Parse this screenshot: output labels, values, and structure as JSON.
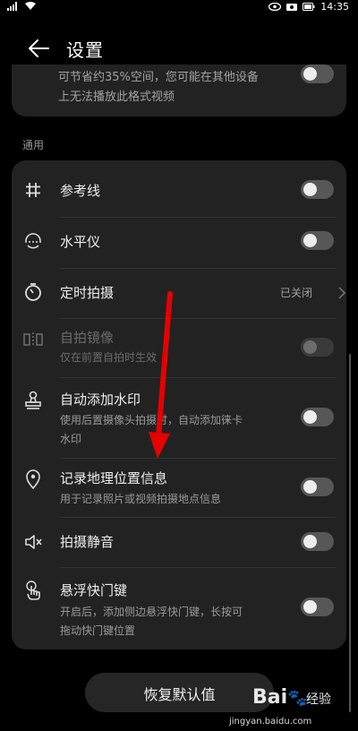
{
  "status": {
    "time": "14:35",
    "battery_icon": "battery-icon"
  },
  "header": {
    "title": "设置"
  },
  "top_card": {
    "text_line1": "可节省约35%空间，您可能在其他设备",
    "text_line2": "上无法播放此格式视频"
  },
  "section": {
    "general": "通用"
  },
  "rows": [
    {
      "label": "参考线",
      "icon": "grid-icon",
      "toggle": "off"
    },
    {
      "label": "水平仪",
      "icon": "level-icon",
      "toggle": "off"
    },
    {
      "label": "定时拍摄",
      "icon": "timer-icon",
      "value": "已关闭"
    },
    {
      "label": "自拍镜像",
      "sub": "仅在前置自拍时生效",
      "icon": "mirror-icon",
      "toggle": "off-disabled"
    },
    {
      "label": "自动添加水印",
      "sub": "使用后置摄像头拍摄时，自动添加徕卡水印",
      "sub_line1": "使用后置摄像头拍摄时，自动添加徕卡",
      "sub_line2": "水印",
      "icon": "stamp-icon",
      "toggle": "off"
    },
    {
      "label": "记录地理位置信息",
      "sub": "用于记录照片或视频拍摄地点信息",
      "icon": "location-icon",
      "toggle": "off"
    },
    {
      "label": "拍摄静音",
      "icon": "mute-icon",
      "toggle": "off"
    },
    {
      "label": "悬浮快门键",
      "sub_line1": "开启后，添加侧边悬浮快门键，长按可",
      "sub_line2": "拖动快门键位置",
      "icon": "touch-icon",
      "toggle": "off"
    }
  ],
  "reset_button": {
    "label": "恢复默认值"
  },
  "watermark": {
    "brand": "Bai",
    "brand2": "经验",
    "url": "jingyan.baidu.com"
  },
  "colors": {
    "background": "#000000",
    "card": "#222222",
    "arrow": "#e60000"
  }
}
